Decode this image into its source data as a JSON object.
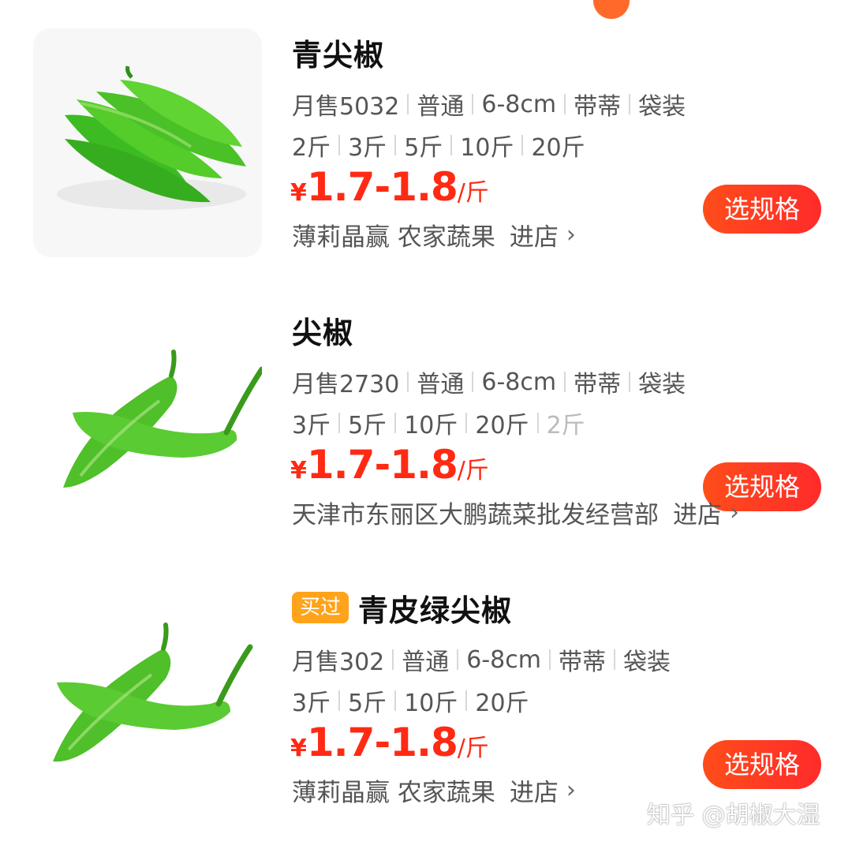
{
  "products": [
    {
      "title": "青尖椒",
      "bought_tag": "",
      "attrs": [
        "月售5032",
        "普通",
        "6-8cm",
        "带蒂",
        "袋装"
      ],
      "specs": [
        "2斤",
        "3斤",
        "5斤",
        "10斤",
        "20斤"
      ],
      "disabled_spec": "",
      "currency": "¥",
      "price": "1.7-1.8",
      "unit": "/斤",
      "button_label": "选规格",
      "shop_name": "薄莉晶赢 农家蔬果",
      "enter_label": "进店"
    },
    {
      "title": "尖椒",
      "bought_tag": "",
      "attrs": [
        "月售2730",
        "普通",
        "6-8cm",
        "带蒂",
        "袋装"
      ],
      "specs": [
        "3斤",
        "5斤",
        "10斤",
        "20斤"
      ],
      "disabled_spec": "2斤",
      "currency": "¥",
      "price": "1.7-1.8",
      "unit": "/斤",
      "button_label": "选规格",
      "shop_name": "天津市东丽区大鹏蔬菜批发经营部",
      "enter_label": "进店"
    },
    {
      "title": "青皮绿尖椒",
      "bought_tag": "买过",
      "attrs": [
        "月售302",
        "普通",
        "6-8cm",
        "带蒂",
        "袋装"
      ],
      "specs": [
        "3斤",
        "5斤",
        "10斤",
        "20斤"
      ],
      "disabled_spec": "",
      "currency": "¥",
      "price": "1.7-1.8",
      "unit": "/斤",
      "button_label": "选规格",
      "shop_name": "薄莉晶赢 农家蔬果",
      "enter_label": "进店"
    }
  ],
  "watermark": "知乎 @胡椒大湿",
  "icons": {
    "enter": "chevron-right-icon"
  },
  "colors": {
    "price": "#ff2a14",
    "button": "#ff3a20",
    "tag": "#ffa31a"
  }
}
